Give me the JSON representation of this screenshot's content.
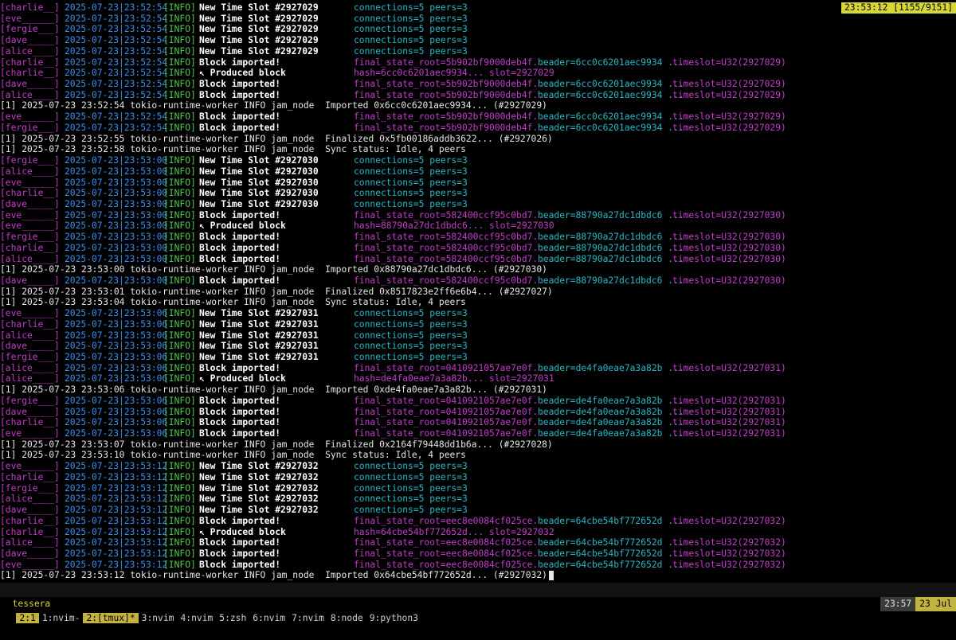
{
  "clock": "23:53:12 [1155/9151]",
  "log": [
    {
      "t": "slot",
      "node": "[charlie__]",
      "ts": "2025-07-23|23:52:54",
      "lv": "[INFO]",
      "msg": "New Time Slot #2927029",
      "conn": "connections=5 peers=3"
    },
    {
      "t": "slot",
      "node": "[eve______]",
      "ts": "2025-07-23|23:52:54",
      "lv": "[INFO]",
      "msg": "New Time Slot #2927029",
      "conn": "connections=5 peers=3"
    },
    {
      "t": "slot",
      "node": "[fergie___]",
      "ts": "2025-07-23|23:52:54",
      "lv": "[INFO]",
      "msg": "New Time Slot #2927029",
      "conn": "connections=5 peers=3"
    },
    {
      "t": "slot",
      "node": "[dave_____]",
      "ts": "2025-07-23|23:52:54",
      "lv": "[INFO]",
      "msg": "New Time Slot #2927029",
      "conn": "connections=5 peers=3"
    },
    {
      "t": "slot",
      "node": "[alice____]",
      "ts": "2025-07-23|23:52:54",
      "lv": "[INFO]",
      "msg": "New Time Slot #2927029",
      "conn": "connections=5 peers=3"
    },
    {
      "t": "imp",
      "node": "[charlie__]",
      "ts": "2025-07-23|23:52:54",
      "lv": "[INFO]",
      "msg": "Block imported!",
      "fsr": "final_state_root=5b902bf9000deb4f...",
      "hdr": "header=6cc0c6201aec9934 ...",
      "tsl": "timeslot=U32(2927029)"
    },
    {
      "t": "prod",
      "node": "[charlie__]",
      "ts": "2025-07-23|23:52:54",
      "lv": "[INFO]",
      "msg": "↖ Produced block",
      "hash": "hash=6cc0c6201aec9934... slot=2927029"
    },
    {
      "t": "imp",
      "node": "[dave_____]",
      "ts": "2025-07-23|23:52:54",
      "lv": "[INFO]",
      "msg": "Block imported!",
      "fsr": "final_state_root=5b902bf9000deb4f...",
      "hdr": "header=6cc0c6201aec9934 ...",
      "tsl": "timeslot=U32(2927029)"
    },
    {
      "t": "imp",
      "node": "[alice____]",
      "ts": "2025-07-23|23:52:54",
      "lv": "[INFO]",
      "msg": "Block imported!",
      "fsr": "final_state_root=5b902bf9000deb4f...",
      "hdr": "header=6cc0c6201aec9934 ...",
      "tsl": "timeslot=U32(2927029)"
    },
    {
      "t": "plain",
      "text": "[1] 2025-07-23 23:52:54 tokio-runtime-worker INFO jam_node  Imported 0x6cc0c6201aec9934... (#2927029)"
    },
    {
      "t": "imp",
      "node": "[eve______]",
      "ts": "2025-07-23|23:52:54",
      "lv": "[INFO]",
      "msg": "Block imported!",
      "fsr": "final_state_root=5b902bf9000deb4f...",
      "hdr": "header=6cc0c6201aec9934 ...",
      "tsl": "timeslot=U32(2927029)"
    },
    {
      "t": "imp",
      "node": "[fergie___]",
      "ts": "2025-07-23|23:52:54",
      "lv": "[INFO]",
      "msg": "Block imported!",
      "fsr": "final_state_root=5b902bf9000deb4f...",
      "hdr": "header=6cc0c6201aec9934 ...",
      "tsl": "timeslot=U32(2927029)"
    },
    {
      "t": "plain",
      "text": "[1] 2025-07-23 23:52:55 tokio-runtime-worker INFO jam_node  Finalized 0x5fb00186addb3622... (#2927026)"
    },
    {
      "t": "plain",
      "text": "[1] 2025-07-23 23:52:58 tokio-runtime-worker INFO jam_node  Sync status: Idle, 4 peers"
    },
    {
      "t": "slot",
      "node": "[fergie___]",
      "ts": "2025-07-23|23:53:00",
      "lv": "[INFO]",
      "msg": "New Time Slot #2927030",
      "conn": "connections=5 peers=3"
    },
    {
      "t": "slot",
      "node": "[alice____]",
      "ts": "2025-07-23|23:53:00",
      "lv": "[INFO]",
      "msg": "New Time Slot #2927030",
      "conn": "connections=5 peers=3"
    },
    {
      "t": "slot",
      "node": "[eve______]",
      "ts": "2025-07-23|23:53:00",
      "lv": "[INFO]",
      "msg": "New Time Slot #2927030",
      "conn": "connections=5 peers=3"
    },
    {
      "t": "slot",
      "node": "[charlie__]",
      "ts": "2025-07-23|23:53:00",
      "lv": "[INFO]",
      "msg": "New Time Slot #2927030",
      "conn": "connections=5 peers=3"
    },
    {
      "t": "slot",
      "node": "[dave_____]",
      "ts": "2025-07-23|23:53:00",
      "lv": "[INFO]",
      "msg": "New Time Slot #2927030",
      "conn": "connections=5 peers=3"
    },
    {
      "t": "imp",
      "node": "[eve______]",
      "ts": "2025-07-23|23:53:00",
      "lv": "[INFO]",
      "msg": "Block imported!",
      "fsr": "final_state_root=582400ccf95c0bd7...",
      "hdr": "header=88790a27dc1dbdc6 ...",
      "tsl": "timeslot=U32(2927030)"
    },
    {
      "t": "prod",
      "node": "[eve______]",
      "ts": "2025-07-23|23:53:00",
      "lv": "[INFO]",
      "msg": "↖ Produced block",
      "hash": "hash=88790a27dc1dbdc6... slot=2927030"
    },
    {
      "t": "imp",
      "node": "[fergie___]",
      "ts": "2025-07-23|23:53:00",
      "lv": "[INFO]",
      "msg": "Block imported!",
      "fsr": "final_state_root=582400ccf95c0bd7...",
      "hdr": "header=88790a27dc1dbdc6 ...",
      "tsl": "timeslot=U32(2927030)"
    },
    {
      "t": "imp",
      "node": "[charlie__]",
      "ts": "2025-07-23|23:53:00",
      "lv": "[INFO]",
      "msg": "Block imported!",
      "fsr": "final_state_root=582400ccf95c0bd7...",
      "hdr": "header=88790a27dc1dbdc6 ...",
      "tsl": "timeslot=U32(2927030)"
    },
    {
      "t": "imp",
      "node": "[alice____]",
      "ts": "2025-07-23|23:53:00",
      "lv": "[INFO]",
      "msg": "Block imported!",
      "fsr": "final_state_root=582400ccf95c0bd7...",
      "hdr": "header=88790a27dc1dbdc6 ...",
      "tsl": "timeslot=U32(2927030)"
    },
    {
      "t": "plain",
      "text": "[1] 2025-07-23 23:53:00 tokio-runtime-worker INFO jam_node  Imported 0x88790a27dc1dbdc6... (#2927030)"
    },
    {
      "t": "imp",
      "node": "[dave_____]",
      "ts": "2025-07-23|23:53:00",
      "lv": "[INFO]",
      "msg": "Block imported!",
      "fsr": "final_state_root=582400ccf95c0bd7...",
      "hdr": "header=88790a27dc1dbdc6 ...",
      "tsl": "timeslot=U32(2927030)"
    },
    {
      "t": "plain",
      "text": "[1] 2025-07-23 23:53:01 tokio-runtime-worker INFO jam_node  Finalized 0x8517823e2ff6e6b4... (#2927027)"
    },
    {
      "t": "plain",
      "text": "[1] 2025-07-23 23:53:04 tokio-runtime-worker INFO jam_node  Sync status: Idle, 4 peers"
    },
    {
      "t": "slot",
      "node": "[eve______]",
      "ts": "2025-07-23|23:53:06",
      "lv": "[INFO]",
      "msg": "New Time Slot #2927031",
      "conn": "connections=5 peers=3"
    },
    {
      "t": "slot",
      "node": "[charlie__]",
      "ts": "2025-07-23|23:53:06",
      "lv": "[INFO]",
      "msg": "New Time Slot #2927031",
      "conn": "connections=5 peers=3"
    },
    {
      "t": "slot",
      "node": "[alice____]",
      "ts": "2025-07-23|23:53:06",
      "lv": "[INFO]",
      "msg": "New Time Slot #2927031",
      "conn": "connections=5 peers=3"
    },
    {
      "t": "slot",
      "node": "[dave_____]",
      "ts": "2025-07-23|23:53:06",
      "lv": "[INFO]",
      "msg": "New Time Slot #2927031",
      "conn": "connections=5 peers=3"
    },
    {
      "t": "slot",
      "node": "[fergie___]",
      "ts": "2025-07-23|23:53:06",
      "lv": "[INFO]",
      "msg": "New Time Slot #2927031",
      "conn": "connections=5 peers=3"
    },
    {
      "t": "imp",
      "node": "[alice____]",
      "ts": "2025-07-23|23:53:06",
      "lv": "[INFO]",
      "msg": "Block imported!",
      "fsr": "final_state_root=0410921057ae7e0f...",
      "hdr": "header=de4fa0eae7a3a82b ...",
      "tsl": "timeslot=U32(2927031)"
    },
    {
      "t": "prod",
      "node": "[alice____]",
      "ts": "2025-07-23|23:53:06",
      "lv": "[INFO]",
      "msg": "↖ Produced block",
      "hash": "hash=de4fa0eae7a3a82b... slot=2927031"
    },
    {
      "t": "plain",
      "text": "[1] 2025-07-23 23:53:06 tokio-runtime-worker INFO jam_node  Imported 0xde4fa0eae7a3a82b... (#2927031)"
    },
    {
      "t": "imp",
      "node": "[fergie___]",
      "ts": "2025-07-23|23:53:06",
      "lv": "[INFO]",
      "msg": "Block imported!",
      "fsr": "final_state_root=0410921057ae7e0f...",
      "hdr": "header=de4fa0eae7a3a82b ...",
      "tsl": "timeslot=U32(2927031)"
    },
    {
      "t": "imp",
      "node": "[dave_____]",
      "ts": "2025-07-23|23:53:06",
      "lv": "[INFO]",
      "msg": "Block imported!",
      "fsr": "final_state_root=0410921057ae7e0f...",
      "hdr": "header=de4fa0eae7a3a82b ...",
      "tsl": "timeslot=U32(2927031)"
    },
    {
      "t": "imp",
      "node": "[charlie__]",
      "ts": "2025-07-23|23:53:06",
      "lv": "[INFO]",
      "msg": "Block imported!",
      "fsr": "final_state_root=0410921057ae7e0f...",
      "hdr": "header=de4fa0eae7a3a82b ...",
      "tsl": "timeslot=U32(2927031)"
    },
    {
      "t": "imp",
      "node": "[eve______]",
      "ts": "2025-07-23|23:53:06",
      "lv": "[INFO]",
      "msg": "Block imported!",
      "fsr": "final_state_root=0410921057ae7e0f...",
      "hdr": "header=de4fa0eae7a3a82b ...",
      "tsl": "timeslot=U32(2927031)"
    },
    {
      "t": "plain",
      "text": "[1] 2025-07-23 23:53:07 tokio-runtime-worker INFO jam_node  Finalized 0x2164f79448dd1b6a... (#2927028)"
    },
    {
      "t": "plain",
      "text": "[1] 2025-07-23 23:53:10 tokio-runtime-worker INFO jam_node  Sync status: Idle, 4 peers"
    },
    {
      "t": "slot",
      "node": "[eve______]",
      "ts": "2025-07-23|23:53:12",
      "lv": "[INFO]",
      "msg": "New Time Slot #2927032",
      "conn": "connections=5 peers=3"
    },
    {
      "t": "slot",
      "node": "[charlie__]",
      "ts": "2025-07-23|23:53:12",
      "lv": "[INFO]",
      "msg": "New Time Slot #2927032",
      "conn": "connections=5 peers=3"
    },
    {
      "t": "slot",
      "node": "[fergie___]",
      "ts": "2025-07-23|23:53:12",
      "lv": "[INFO]",
      "msg": "New Time Slot #2927032",
      "conn": "connections=5 peers=3"
    },
    {
      "t": "slot",
      "node": "[alice____]",
      "ts": "2025-07-23|23:53:12",
      "lv": "[INFO]",
      "msg": "New Time Slot #2927032",
      "conn": "connections=5 peers=3"
    },
    {
      "t": "slot",
      "node": "[dave_____]",
      "ts": "2025-07-23|23:53:12",
      "lv": "[INFO]",
      "msg": "New Time Slot #2927032",
      "conn": "connections=5 peers=3"
    },
    {
      "t": "imp",
      "node": "[charlie__]",
      "ts": "2025-07-23|23:53:12",
      "lv": "[INFO]",
      "msg": "Block imported!",
      "fsr": "final_state_root=eec8e0084cf025ce...",
      "hdr": "header=64cbe54bf772652d ...",
      "tsl": "timeslot=U32(2927032)"
    },
    {
      "t": "prod",
      "node": "[charlie__]",
      "ts": "2025-07-23|23:53:12",
      "lv": "[INFO]",
      "msg": "↖ Produced block",
      "hash": "hash=64cbe54bf772652d... slot=2927032"
    },
    {
      "t": "imp",
      "node": "[alice____]",
      "ts": "2025-07-23|23:53:12",
      "lv": "[INFO]",
      "msg": "Block imported!",
      "fsr": "final_state_root=eec8e0084cf025ce...",
      "hdr": "header=64cbe54bf772652d ...",
      "tsl": "timeslot=U32(2927032)"
    },
    {
      "t": "imp",
      "node": "[dave_____]",
      "ts": "2025-07-23|23:53:12",
      "lv": "[INFO]",
      "msg": "Block imported!",
      "fsr": "final_state_root=eec8e0084cf025ce...",
      "hdr": "header=64cbe54bf772652d ...",
      "tsl": "timeslot=U32(2927032)"
    },
    {
      "t": "imp",
      "node": "[eve______]",
      "ts": "2025-07-23|23:53:12",
      "lv": "[INFO]",
      "msg": "Block imported!",
      "fsr": "final_state_root=eec8e0084cf025ce...",
      "hdr": "header=64cbe54bf772652d ...",
      "tsl": "timeslot=U32(2927032)"
    },
    {
      "t": "plain",
      "cursor": true,
      "text": "[1] 2025-07-23 23:53:12 tokio-runtime-worker INFO jam_node  Imported 0x64cbe54bf772652d... (#2927032)"
    }
  ],
  "status": {
    "session": "tessera",
    "windows": [
      {
        "label": "2:1",
        "hl": true
      },
      {
        "label": "1:nvim-",
        "hl": false
      },
      {
        "label": "2:[tmux]*",
        "hl": true
      },
      {
        "label": "3:nvim",
        "hl": false
      },
      {
        "label": "4:nvim",
        "hl": false
      },
      {
        "label": "5:zsh",
        "hl": false
      },
      {
        "label": "6:nvim",
        "hl": false
      },
      {
        "label": "7:nvim",
        "hl": false
      },
      {
        "label": "8:node",
        "hl": false
      },
      {
        "label": "9:python3",
        "hl": false
      }
    ],
    "time": "23:57",
    "date": "23 Jul"
  }
}
